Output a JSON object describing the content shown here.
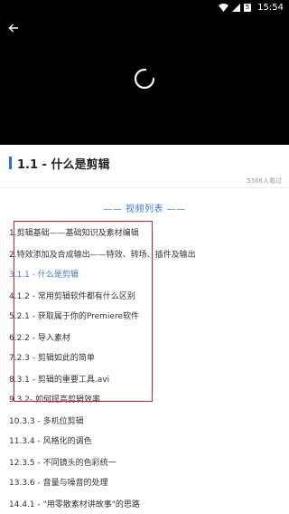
{
  "status_bar": {
    "time": "15:54",
    "battery_badge": "5"
  },
  "video": {
    "back_icon": "back-arrow-icon",
    "loading_icon": "spinner-icon"
  },
  "lesson": {
    "title": "1.1 - 什么是剪辑",
    "views": "5366人看过"
  },
  "list_header": "—— 视频列表 ——",
  "accent_color": "#3a7bd5",
  "highlight_color": "#d62020",
  "episodes": [
    {
      "label": "1.剪辑基础——基础知识及素材编辑",
      "active": false
    },
    {
      "label": "2.特效添加及合成输出——特效、转场、插件及输出",
      "active": false
    },
    {
      "label": "3.1.1 - 什么是剪辑",
      "active": true
    },
    {
      "label": "4.1.2 - 常用剪辑软件都有什么区别",
      "active": false
    },
    {
      "label": "5.2.1 - 获取属于你的Premiere软件",
      "active": false
    },
    {
      "label": "6.2.2 - 导入素材",
      "active": false
    },
    {
      "label": "7.2.3 - 剪辑如此的简单",
      "active": false
    },
    {
      "label": "8.3.1 - 剪辑的重要工具.avi",
      "active": false
    },
    {
      "label": "9.3.2- 如何提高剪辑效率",
      "active": false
    },
    {
      "label": "10.3.3 - 多机位剪辑",
      "active": false
    },
    {
      "label": "11.3.4 - 风格化的调色",
      "active": false
    },
    {
      "label": "12.3.5 - 不同镜头的色彩统一",
      "active": false
    },
    {
      "label": "13.3.6 - 音量与噪音的处理",
      "active": false
    },
    {
      "label": "14.4.1 - \"用零散素材讲故事\"的思路",
      "active": false
    }
  ]
}
